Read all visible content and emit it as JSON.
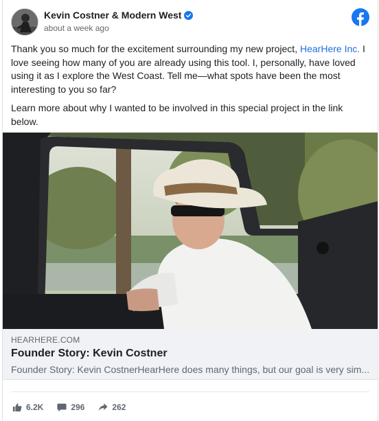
{
  "post": {
    "page_name": "Kevin Costner & Modern West",
    "timestamp": "about a week ago",
    "text_part1": "Thank you so much for the excitement surrounding my new project, ",
    "mention": "HearHere Inc.",
    "text_part2": " I love seeing how many of you are already using this tool. I, personally, have loved using it as I explore the West Coast. Tell me—what spots have been the most interesting to you so far?",
    "text_paragraph2": "Learn more about why I wanted to be involved in this special project in the link below.",
    "icons": [
      "verified-badge-icon",
      "facebook-logo-icon"
    ],
    "colors": {
      "link": "#216fdb",
      "brand": "#1877f2",
      "muted": "#65676b"
    }
  },
  "link_preview": {
    "domain": "HEARHERE.COM",
    "title": "Founder Story: Kevin Costner",
    "description": "Founder Story: Kevin CostnerHearHere does many things, but our goal is very sim..."
  },
  "stats": {
    "likes": "6.2K",
    "comments": "296",
    "shares": "262",
    "icons": [
      "like-icon",
      "comment-icon",
      "share-icon"
    ]
  }
}
